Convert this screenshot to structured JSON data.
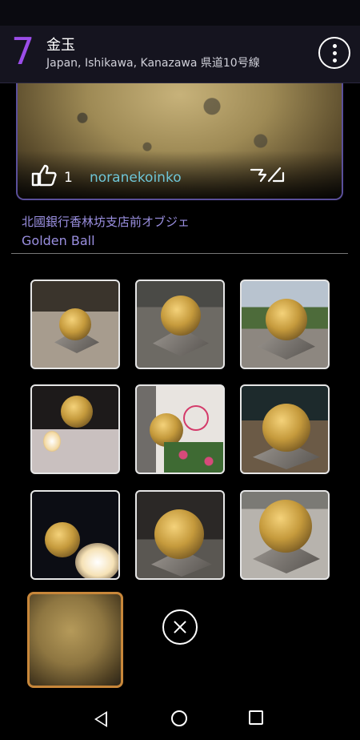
{
  "header": {
    "number": "7",
    "title": "金玉",
    "subtitle": "Japan, Ishikawa, Kanazawa 県道10号線"
  },
  "hero": {
    "like_count": "1",
    "author": "noranekoinko",
    "icons": {
      "like": "thumbs-up-icon",
      "report": "report-flag-icon"
    }
  },
  "description": {
    "japanese": "北國銀行香林坊支店前オブジェ",
    "english": "Golden Ball"
  },
  "gallery": {
    "thumbnails": [
      "photo-1",
      "photo-2",
      "photo-3",
      "photo-4",
      "photo-5",
      "photo-6",
      "photo-7",
      "photo-8",
      "photo-9"
    ],
    "selected": "photo-10",
    "close_icon": "close-circle-icon"
  },
  "navbar": {
    "icons": [
      "back-icon",
      "home-icon",
      "recents-icon"
    ]
  },
  "colors": {
    "accent_purple": "#9b4de8",
    "author_cyan": "#6ec5d6",
    "desc_lavender": "#9a8fe0",
    "selected_border": "#c8873a"
  }
}
